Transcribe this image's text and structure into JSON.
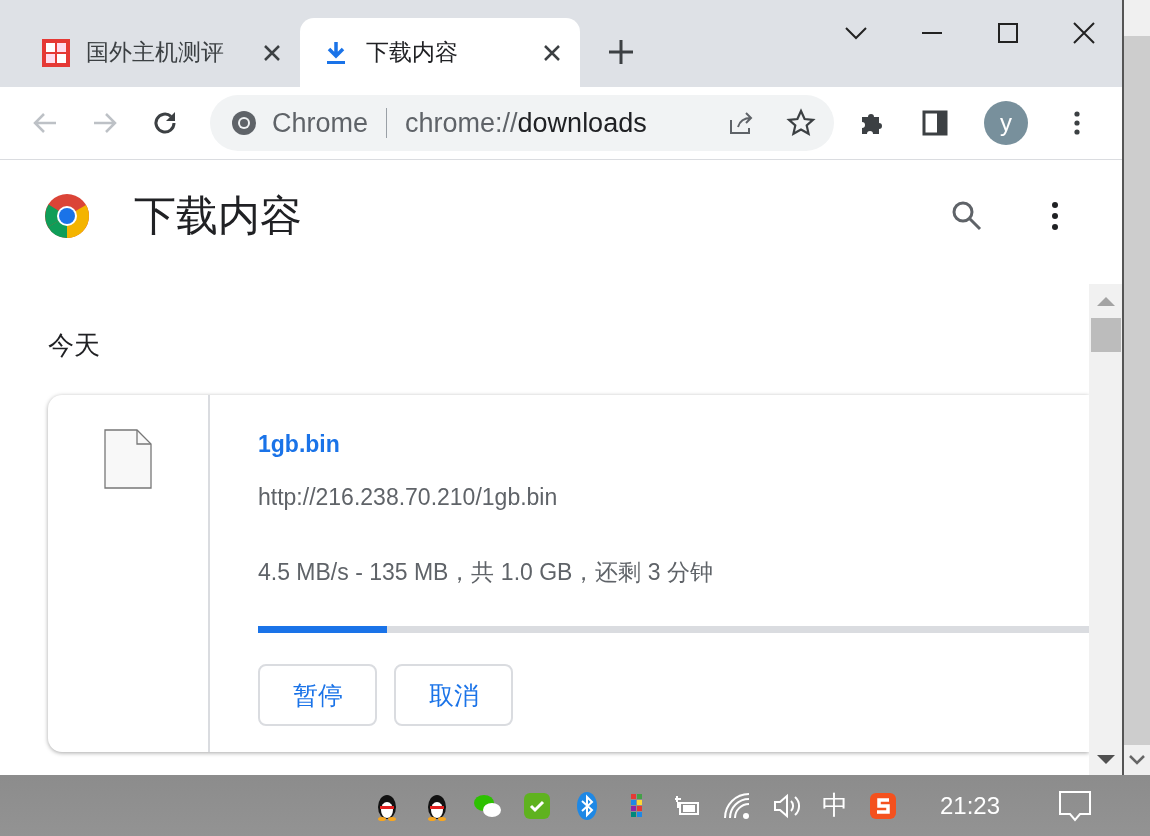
{
  "tabs": [
    {
      "title": "国外主机测评",
      "selected": false,
      "kind": "site"
    },
    {
      "title": "下载内容",
      "selected": true,
      "kind": "download"
    }
  ],
  "address_bar": {
    "site_label": "Chrome",
    "url_prefix": "chrome://",
    "url_host": "downloads"
  },
  "profile_initial": "y",
  "page": {
    "title": "下载内容"
  },
  "downloads": {
    "date_heading": "今天",
    "items": [
      {
        "filename": "1gb.bin",
        "url": "http://216.238.70.210/1gb.bin",
        "status": "4.5 MB/s - 135 MB，共 1.0 GB，还剩 3 分钟",
        "level": 0.155,
        "buttons": [
          "暂停",
          "取消"
        ]
      }
    ]
  },
  "taskbar": {
    "input_method": "中",
    "clock": "21:23"
  }
}
